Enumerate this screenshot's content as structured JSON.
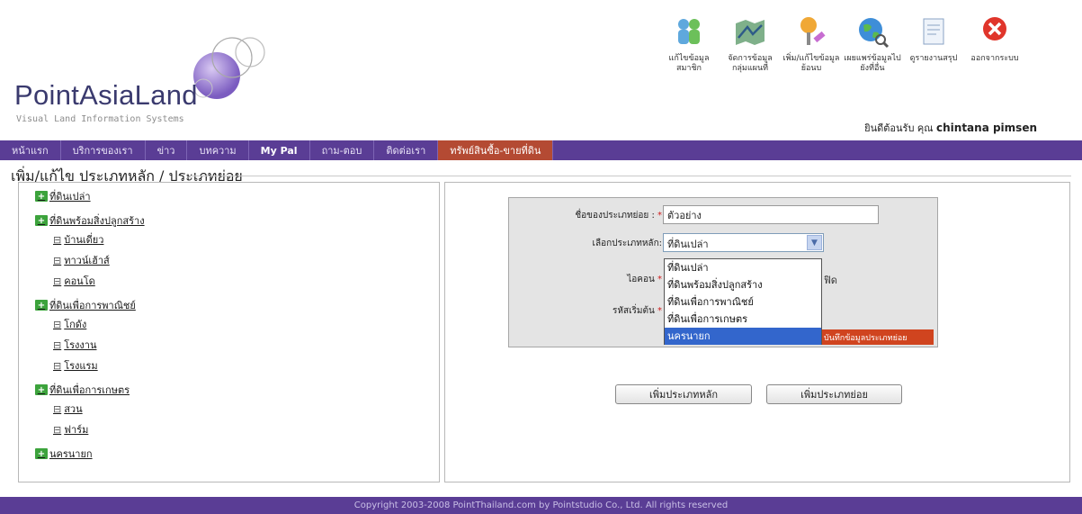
{
  "header": {
    "logo_title": "PointAsiaLand",
    "logo_subtitle": "Visual Land Information Systems",
    "welcome_prefix": "ยินดีต้อนรับ คุณ",
    "user_name": "chintana pimsen",
    "toolbar": [
      {
        "label": "แก้ไขข้อมูลสมาชิก",
        "icon": "members-icon"
      },
      {
        "label": "จัดการข้อมูลกลุ่มแผนที่",
        "icon": "map-data-icon"
      },
      {
        "label": "เพิ่ม/แก้ไขข้อมูลย้อนบ",
        "icon": "edit-pin-icon"
      },
      {
        "label": "เผยแพร่ข้อมูลไปยังที่อื่น",
        "icon": "globe-icon"
      },
      {
        "label": "ดูรายงานสรุป",
        "icon": "report-icon"
      },
      {
        "label": "ออกจากระบบ",
        "icon": "logout-icon"
      }
    ]
  },
  "nav": {
    "items": [
      "หน้าแรก",
      "บริการของเรา",
      "ข่าว",
      "บทความ",
      "My Pal",
      "ถาม-ตอบ",
      "ติดต่อเรา",
      "ทรัพย์สินซื้อ-ขายที่ดิน"
    ],
    "active_index": 7
  },
  "page_title": "เพิ่ม/แก้ไข ประเภทหลัก / ประเภทย่อย",
  "tree": {
    "items": [
      {
        "label": "ที่ดินเปล่า",
        "level": 0
      },
      {
        "label": "ที่ดินพร้อมสิ่งปลูกสร้าง",
        "level": 0
      },
      {
        "label": "บ้านเดี่ยว",
        "level": 1
      },
      {
        "label": "ทาวน์เฮ้าส์",
        "level": 1
      },
      {
        "label": "คอนโด",
        "level": 1
      },
      {
        "label": "ที่ดินเพื่อการพาณิชย์",
        "level": 0
      },
      {
        "label": "โกดัง",
        "level": 1
      },
      {
        "label": "โรงงาน",
        "level": 1
      },
      {
        "label": "โรงแรม",
        "level": 1
      },
      {
        "label": "ที่ดินเพื่อการเกษตร",
        "level": 0
      },
      {
        "label": "สวน",
        "level": 1
      },
      {
        "label": "ฟาร์ม",
        "level": 1
      },
      {
        "label": "นครนายก",
        "level": 0
      }
    ]
  },
  "form": {
    "subtype_label": "ชื่อของประเภทย่อย :",
    "subtype_value": "ตัวอย่าง",
    "maintype_label": "เลือกประเภทหลัก:",
    "maintype_value": "ที่ดินเปล่า",
    "icon_label": "ไอคอน",
    "icon_hint": "ฟิด",
    "prefix_label": "รหัสเริ่มต้น",
    "options": [
      "ที่ดินเปล่า",
      "ที่ดินพร้อมสิ่งปลูกสร้าง",
      "ที่ดินเพื่อการพาณิชย์",
      "ที่ดินเพื่อการเกษตร",
      "นครนายก"
    ],
    "highlighted_option": 4,
    "save_label": "บันทึกข้อมูลประเภทย่อย",
    "add_main_label": "เพิ่มประเภทหลัก",
    "add_sub_label": "เพิ่มประเภทย่อย"
  },
  "footer": "Copyright 2003-2008 PointThailand.com by Pointstudio Co., Ltd. All rights reserved"
}
